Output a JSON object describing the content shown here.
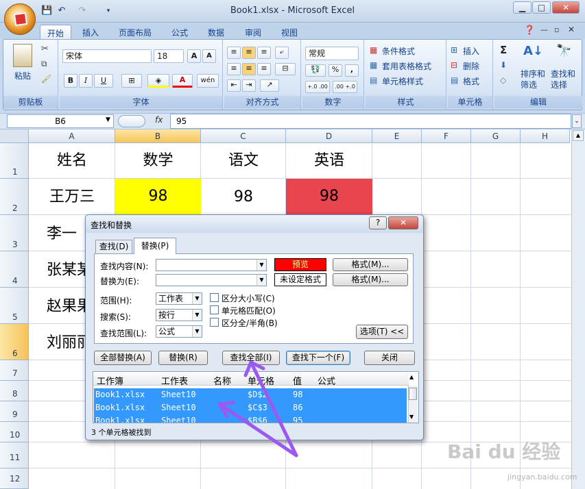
{
  "window": {
    "title": "Book1.xlsx - Microsoft Excel",
    "min": "▭",
    "max": "⧉",
    "close": "✕"
  },
  "tabs": [
    "开始",
    "插入",
    "页面布局",
    "公式",
    "数据",
    "审阅",
    "视图"
  ],
  "ribbon": {
    "clipboard": {
      "paste": "粘贴",
      "label": "剪贴板"
    },
    "font": {
      "name": "宋体",
      "size": "18",
      "grow": "A",
      "shrink": "A",
      "bold": "B",
      "italic": "I",
      "underline": "U",
      "label": "字体",
      "fontcolor": "A",
      "wen": "wén"
    },
    "alignment": {
      "label": "对齐方式"
    },
    "number": {
      "format": "常规",
      "percent": "%",
      "comma": ",",
      "inc": "+.0 .00",
      "dec": ".00 +.0",
      "label": "数字"
    },
    "styles": {
      "cond": "条件格式",
      "table": "套用表格格式",
      "cell": "单元格样式",
      "label": "样式"
    },
    "cells": {
      "insert": "插入",
      "delete": "删除",
      "format": "格式",
      "label": "单元格"
    },
    "editing": {
      "sum": "Σ",
      "sort": "排序和\n筛选",
      "find": "查找和\n选择",
      "label": "编辑"
    }
  },
  "formula_bar": {
    "cell": "B6",
    "fx": "fx",
    "value": "95"
  },
  "columns": [
    "A",
    "B",
    "C",
    "D",
    "E",
    "F",
    "G",
    "H"
  ],
  "rows": [
    "1",
    "2",
    "3",
    "4",
    "5",
    "6",
    "7",
    "8",
    "9",
    "10",
    "11",
    "12"
  ],
  "cells": {
    "a1": "姓名",
    "b1": "数学",
    "c1": "语文",
    "d1": "英语",
    "a2": "王万三",
    "b2": "98",
    "c2": "98",
    "d2": "98",
    "a3": "李一",
    "a4": "张某某",
    "a5": "赵果果",
    "a6": "刘丽丽"
  },
  "dialog": {
    "title": "查找和替换",
    "help": "?",
    "close": "✕",
    "tab_find": "查找(D)",
    "tab_replace": "替换(P)",
    "find_what": "查找内容(N):",
    "replace_with": "替换为(E):",
    "preview": "预览",
    "no_format": "未设定格式",
    "format_btn": "格式(M)...",
    "within_label": "范围(H):",
    "within_val": "工作表",
    "search_label": "搜索(S):",
    "search_val": "按行",
    "lookin_label": "查找范围(L):",
    "lookin_val": "公式",
    "match_case": "区分大小写(C)",
    "match_cell": "单元格匹配(O)",
    "match_width": "区分全/半角(B)",
    "options": "选项(T) <<",
    "replace_all": "全部替换(A)",
    "replace": "替换(R)",
    "find_all": "查找全部(I)",
    "find_next": "查找下一个(F)",
    "close_btn": "关闭",
    "headers": [
      "工作簿",
      "工作表",
      "名称",
      "单元格",
      "值",
      "公式"
    ],
    "results": [
      {
        "book": "Book1.xlsx",
        "sheet": "Sheet10",
        "cell": "$D$2",
        "value": "98"
      },
      {
        "book": "Book1.xlsx",
        "sheet": "Sheet10",
        "cell": "$C$3",
        "value": "86"
      },
      {
        "book": "Book1.xlsx",
        "sheet": "Sheet10",
        "cell": "$B$6",
        "value": "95"
      }
    ],
    "status": "3 个单元格被找到"
  },
  "watermark": {
    "brand": "Bai du 经验",
    "url": "jingyan.baidu.com"
  },
  "colors": {
    "yellow": "#ffff00",
    "red": "#e8454f",
    "arrow": "#9b59f0",
    "select": "#3399ff"
  }
}
